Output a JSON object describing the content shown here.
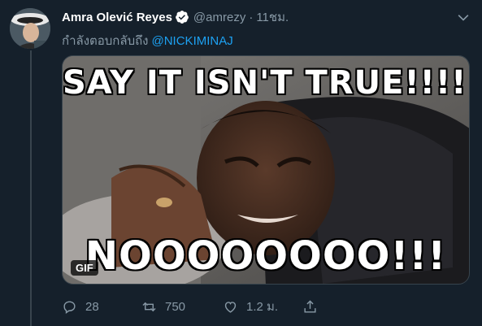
{
  "author": {
    "display_name": "Amra Olević Reyes",
    "handle": "@amrezy",
    "separator": "·",
    "time": "11ชม."
  },
  "reply_context": {
    "prefix": "กำลังตอบกลับถึง",
    "mention": "@NICKIMINAJ"
  },
  "media": {
    "top_caption": "SAY IT ISN'T TRUE!!!!!",
    "bottom_caption": "NOOOOOOOO!!!",
    "badge": "GIF"
  },
  "actions": {
    "replies": "28",
    "retweets": "750",
    "likes": "1.2 ม."
  },
  "colors": {
    "background": "#15202b",
    "accent": "#1da1f2",
    "muted": "#8899a6",
    "border": "#38444d"
  }
}
